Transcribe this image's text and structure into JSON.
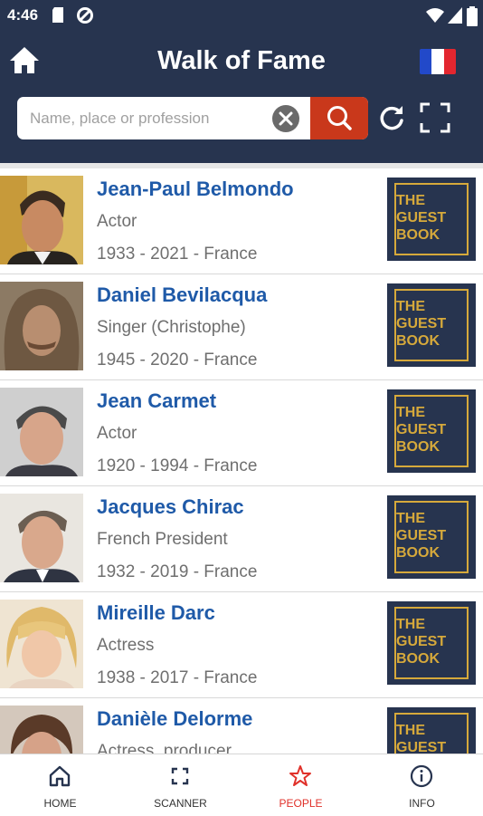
{
  "status_bar": {
    "time": "4:46"
  },
  "header": {
    "title": "Walk of Fame"
  },
  "search": {
    "placeholder": "Name, place or profession",
    "value": ""
  },
  "colors": {
    "primary": "#27344f",
    "accent": "#c9381b",
    "link": "#1f5aa8",
    "gold": "#d6a93b",
    "active_tab": "#e0312a"
  },
  "people": [
    {
      "name": "Jean-Paul Belmondo",
      "role": "Actor",
      "dates": "1933 - 2021  -  France",
      "badge": "THE\nGUEST\nBOOK"
    },
    {
      "name": "Daniel Bevilacqua",
      "role": "Singer (Christophe)",
      "dates": "1945 - 2020  -  France",
      "badge": "THE\nGUEST\nBOOK"
    },
    {
      "name": "Jean Carmet",
      "role": "Actor",
      "dates": "1920 - 1994  -  France",
      "badge": "THE\nGUEST\nBOOK"
    },
    {
      "name": "Jacques Chirac",
      "role": "French President",
      "dates": "1932 - 2019  -  France",
      "badge": "THE\nGUEST\nBOOK"
    },
    {
      "name": "Mireille Darc",
      "role": "Actress",
      "dates": "1938 - 2017  -  France",
      "badge": "THE\nGUEST\nBOOK"
    },
    {
      "name": "Danièle Delorme",
      "role": "Actress, producer",
      "dates": "",
      "badge": "THE\nGUEST\nBOOK"
    }
  ],
  "bottom_nav": [
    {
      "label": "HOME",
      "icon": "home-icon"
    },
    {
      "label": "SCANNER",
      "icon": "scanner-icon"
    },
    {
      "label": "PEOPLE",
      "icon": "star-icon",
      "active": true
    },
    {
      "label": "INFO",
      "icon": "info-icon"
    }
  ]
}
